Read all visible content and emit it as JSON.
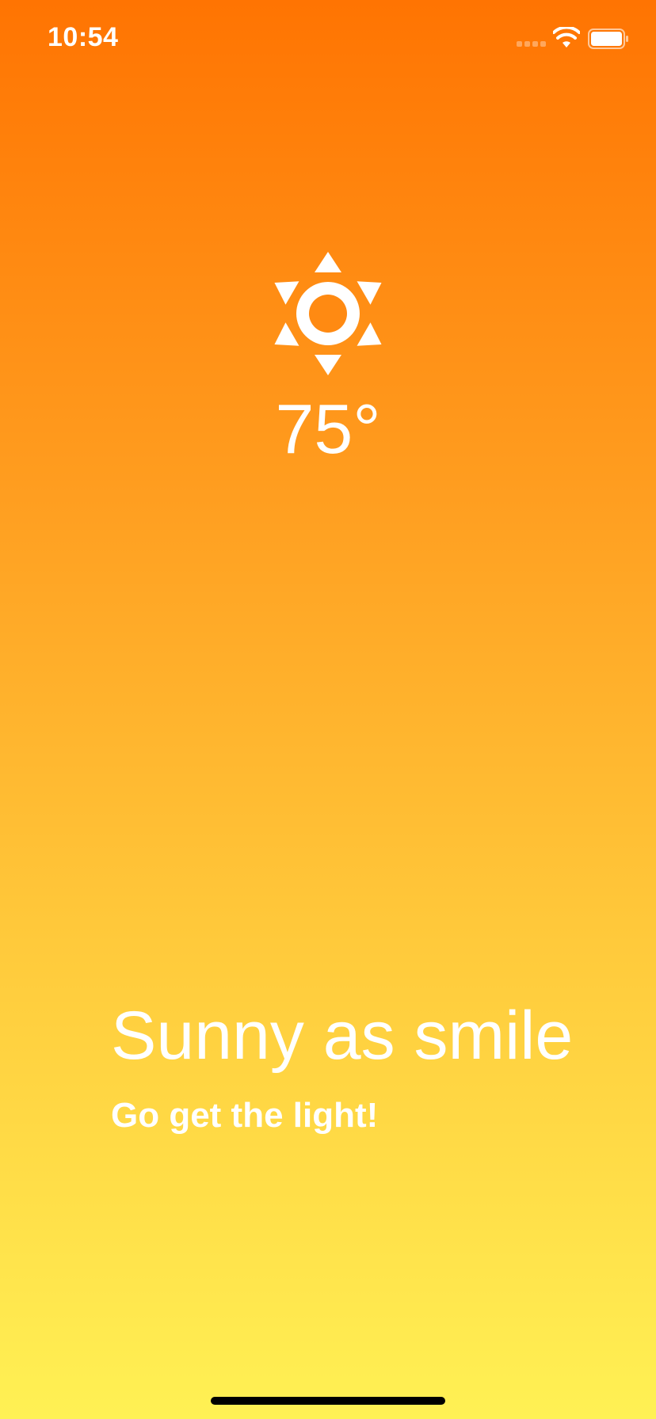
{
  "status_bar": {
    "time": "10:54",
    "signal_icon": "cellular-signal-icon",
    "wifi_icon": "wifi-icon",
    "battery_icon": "battery-icon"
  },
  "weather": {
    "icon": "sun-icon",
    "temperature": "75°",
    "headline": "Sunny as smile",
    "subline": "Go get the light!"
  },
  "colors": {
    "gradient_top": "#ff7402",
    "gradient_bottom": "#fff154",
    "text": "#ffffff"
  }
}
